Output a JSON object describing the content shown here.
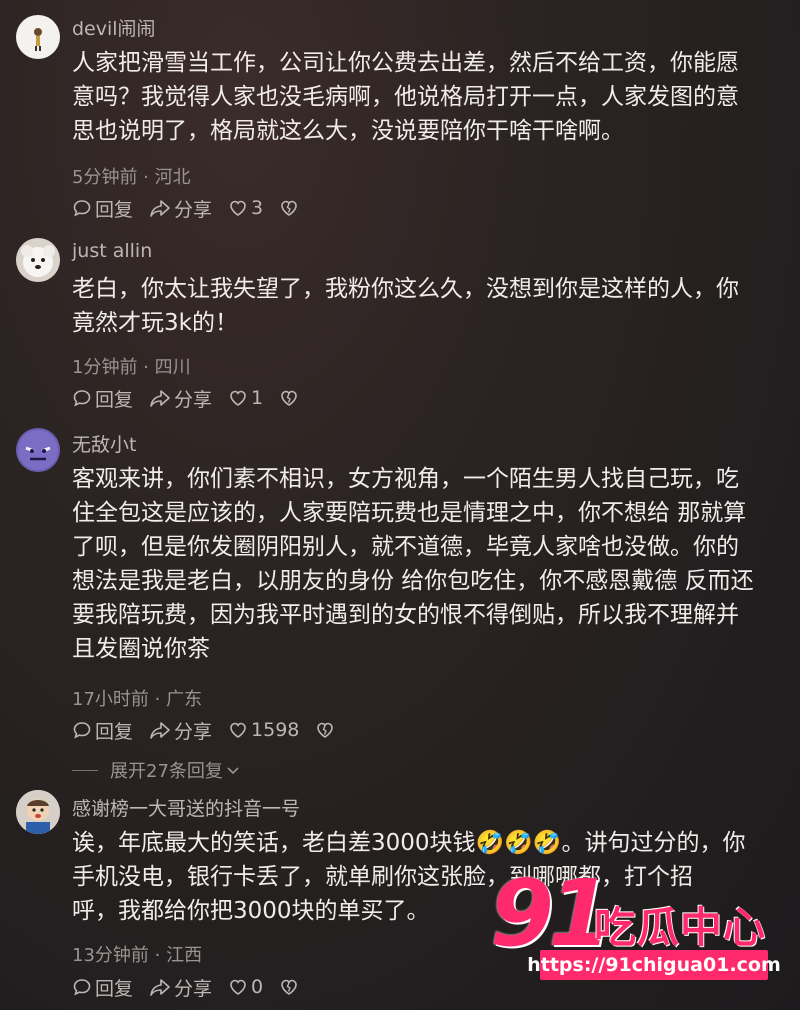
{
  "comments": [
    {
      "username": "devil闹闹",
      "lines": [
        "人家把滑雪当工作，公司让你公费去出差，然后不给工资，你能愿",
        "意吗？我觉得人家也没毛病啊，他说格局打开一点，人家发图的意",
        "思也说明了，格局就这么大，没说要陪你干啥干啥啊。"
      ],
      "meta": "5分钟前 · 河北",
      "reply": "回复",
      "share": "分享",
      "likes": "3",
      "avatar_icon": "stick-figure-icon"
    },
    {
      "username": "just allin",
      "lines": [
        "老白，你太让我失望了，我粉你这么久，没想到你是这样的人，你",
        "竟然才玩3k的！"
      ],
      "meta": "1分钟前 · 四川",
      "reply": "回复",
      "share": "分享",
      "likes": "1",
      "avatar_icon": "white-dog-icon"
    },
    {
      "username": "无敌小t",
      "lines": [
        "客观来讲，你们素不相识，女方视角，一个陌生男人找自己玩，吃",
        "住全包这是应该的，人家要陪玩费也是情理之中，你不想给 那就算",
        "了呗，但是你发圈阴阳别人，就不道德，毕竟人家啥也没做。你的",
        "想法是我是老白，以朋友的身份 给你包吃住，你不感恩戴德 反而还",
        "要我陪玩费，因为我平时遇到的女的恨不得倒贴，所以我不理解并",
        "且发圈说你茶"
      ],
      "meta": "17小时前 · 广东",
      "reply": "回复",
      "share": "分享",
      "likes": "1598",
      "avatar_icon": "purple-monster-icon"
    },
    {
      "username": "感谢榜一大哥送的抖音一号",
      "lines": [
        "诶，年底最大的笑话，老白差3000块钱🤣🤣🤣。讲句过分的，你",
        "手机没电，银行卡丢了，就单刷你这张脸，到哪哪都，打个招",
        "呼，我都给你把3000块的单买了。"
      ],
      "meta": "13分钟前 · 江西",
      "reply": "回复",
      "share": "分享",
      "likes": "0",
      "avatar_icon": "baby-photo-icon"
    }
  ],
  "expand_replies": "展开27条回复",
  "watermark": {
    "number": "91",
    "name": "吃瓜中心",
    "url": "https://91chigua01.com"
  },
  "colors": {
    "accent": "#ff2a6d",
    "background": "#231f20",
    "text": "#f1ecea",
    "muted": "#9b9391"
  }
}
